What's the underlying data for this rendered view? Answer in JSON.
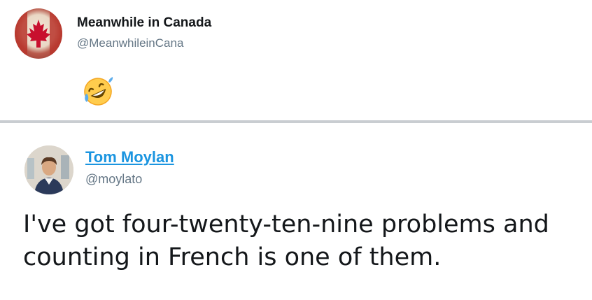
{
  "top_tweet": {
    "display_name": "Meanwhile in Canada",
    "handle": "@MeanwhileinCana",
    "reply_emoji": "rolling-on-floor-laughing-emoji",
    "avatar": "canadian-flag-avatar"
  },
  "bottom_tweet": {
    "display_name": "Tom Moylan",
    "handle": "@moylato",
    "text_lines": [
      "I've got four-twenty-ten-nine problems and",
      "counting in French is one of them."
    ],
    "avatar": "profile-photo-avatar"
  },
  "colors": {
    "link_blue": "#1b95e0",
    "handle_gray": "#657786",
    "divider_gray": "#c9cdd1",
    "flag_red": "#c8102e"
  }
}
